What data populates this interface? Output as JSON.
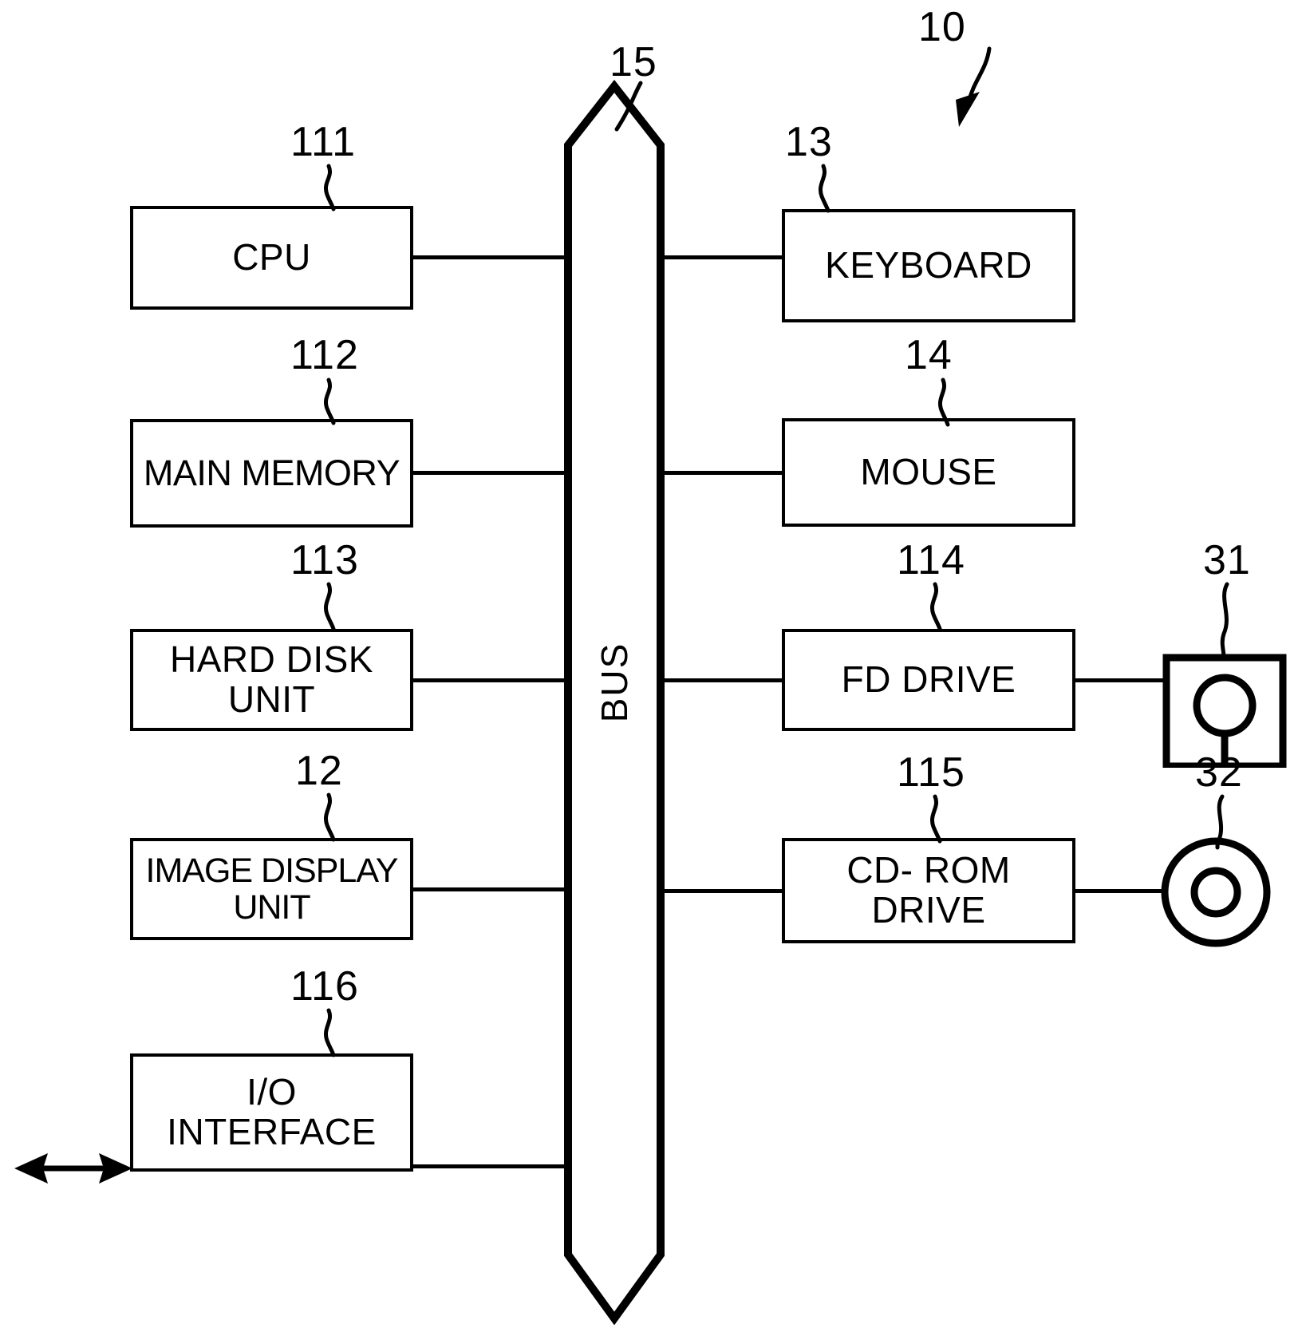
{
  "figure": {
    "type": "patent-block-diagram",
    "system_reference": "10",
    "bus_label": "BUS",
    "bus_reference": "15"
  },
  "left_blocks": [
    {
      "label": "CPU",
      "ref": "111"
    },
    {
      "label": "MAIN MEMORY",
      "ref": "112"
    },
    {
      "label": "HARD DISK\nUNIT",
      "ref": "113"
    },
    {
      "label": "IMAGE DISPLAY\nUNIT",
      "ref": "12"
    },
    {
      "label": "I/O\nINTERFACE",
      "ref": "116"
    }
  ],
  "right_blocks": [
    {
      "label": "KEYBOARD",
      "ref": "13"
    },
    {
      "label": "MOUSE",
      "ref": "14"
    },
    {
      "label": "FD DRIVE",
      "ref": "114"
    },
    {
      "label": "CD- ROM\nDRIVE",
      "ref": "115"
    }
  ],
  "media": [
    {
      "name": "floppy-disk",
      "ref": "31"
    },
    {
      "name": "compact-disc",
      "ref": "32"
    }
  ],
  "colors": {
    "line": "#000000",
    "background": "#ffffff"
  }
}
